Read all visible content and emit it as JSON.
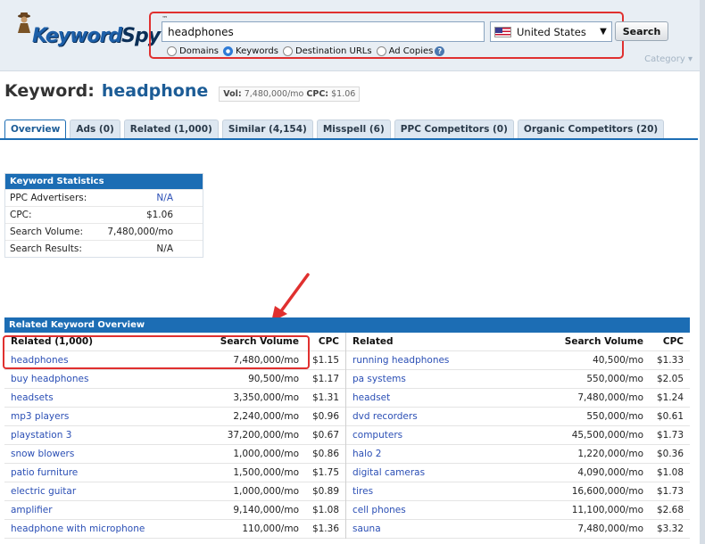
{
  "header": {
    "logo_key": "Keyword",
    "logo_spy": "Spy",
    "logo_tm": "™",
    "search_value": "headphones",
    "country": "United States",
    "search_button": "Search",
    "radio": [
      {
        "label": "Domains",
        "checked": false
      },
      {
        "label": "Keywords",
        "checked": true
      },
      {
        "label": "Destination URLs",
        "checked": false
      },
      {
        "label": "Ad Copies",
        "checked": false
      }
    ],
    "help_icon_glyph": "?",
    "category_link": "Category ▾"
  },
  "title": {
    "label": "Keyword:",
    "keyword": "headphone",
    "vol_label": "Vol:",
    "vol_value": "7,480,000/mo",
    "cpc_label": "CPC:",
    "cpc_value": "$1.06"
  },
  "tabs": [
    {
      "label": "Overview",
      "active": true
    },
    {
      "label": "Ads (0)",
      "active": false
    },
    {
      "label": "Related (1,000)",
      "active": false
    },
    {
      "label": "Similar (4,154)",
      "active": false
    },
    {
      "label": "Misspell (6)",
      "active": false
    },
    {
      "label": "PPC Competitors (0)",
      "active": false
    },
    {
      "label": "Organic Competitors (20)",
      "active": false
    }
  ],
  "keyword_statistics": {
    "heading": "Keyword Statistics",
    "rows": [
      {
        "label": "PPC Advertisers:",
        "value": "N/A"
      },
      {
        "label": "CPC:",
        "value": "$1.06"
      },
      {
        "label": "Search Volume:",
        "value": "7,480,000/mo"
      },
      {
        "label": "Search Results:",
        "value": "N/A"
      }
    ]
  },
  "related_overview": {
    "heading": "Related Keyword Overview",
    "left_headers": [
      "Related (1,000)",
      "Search Volume",
      "CPC"
    ],
    "right_headers": [
      "Related",
      "Search Volume",
      "CPC"
    ],
    "left_rows": [
      [
        "headphones",
        "7,480,000/mo",
        "$1.15"
      ],
      [
        "buy headphones",
        "90,500/mo",
        "$1.17"
      ],
      [
        "headsets",
        "3,350,000/mo",
        "$1.31"
      ],
      [
        "mp3 players",
        "2,240,000/mo",
        "$0.96"
      ],
      [
        "playstation 3",
        "37,200,000/mo",
        "$0.67"
      ],
      [
        "snow blowers",
        "1,000,000/mo",
        "$0.86"
      ],
      [
        "patio furniture",
        "1,500,000/mo",
        "$1.75"
      ],
      [
        "electric guitar",
        "1,000,000/mo",
        "$0.89"
      ],
      [
        "amplifier",
        "9,140,000/mo",
        "$1.08"
      ],
      [
        "headphone with microphone",
        "110,000/mo",
        "$1.36"
      ]
    ],
    "right_rows": [
      [
        "running headphones",
        "40,500/mo",
        "$1.33"
      ],
      [
        "pa systems",
        "550,000/mo",
        "$2.05"
      ],
      [
        "headset",
        "7,480,000/mo",
        "$1.24"
      ],
      [
        "dvd recorders",
        "550,000/mo",
        "$0.61"
      ],
      [
        "computers",
        "45,500,000/mo",
        "$1.73"
      ],
      [
        "halo 2",
        "1,220,000/mo",
        "$0.36"
      ],
      [
        "digital cameras",
        "4,090,000/mo",
        "$1.08"
      ],
      [
        "tires",
        "16,600,000/mo",
        "$1.73"
      ],
      [
        "cell phones",
        "11,100,000/mo",
        "$2.68"
      ],
      [
        "sauna",
        "7,480,000/mo",
        "$3.32"
      ]
    ]
  },
  "colors": {
    "accent": "#1c6db4",
    "link": "#2b4fb5",
    "annotation": "#e0302f",
    "header_bg": "#e8eef4"
  }
}
